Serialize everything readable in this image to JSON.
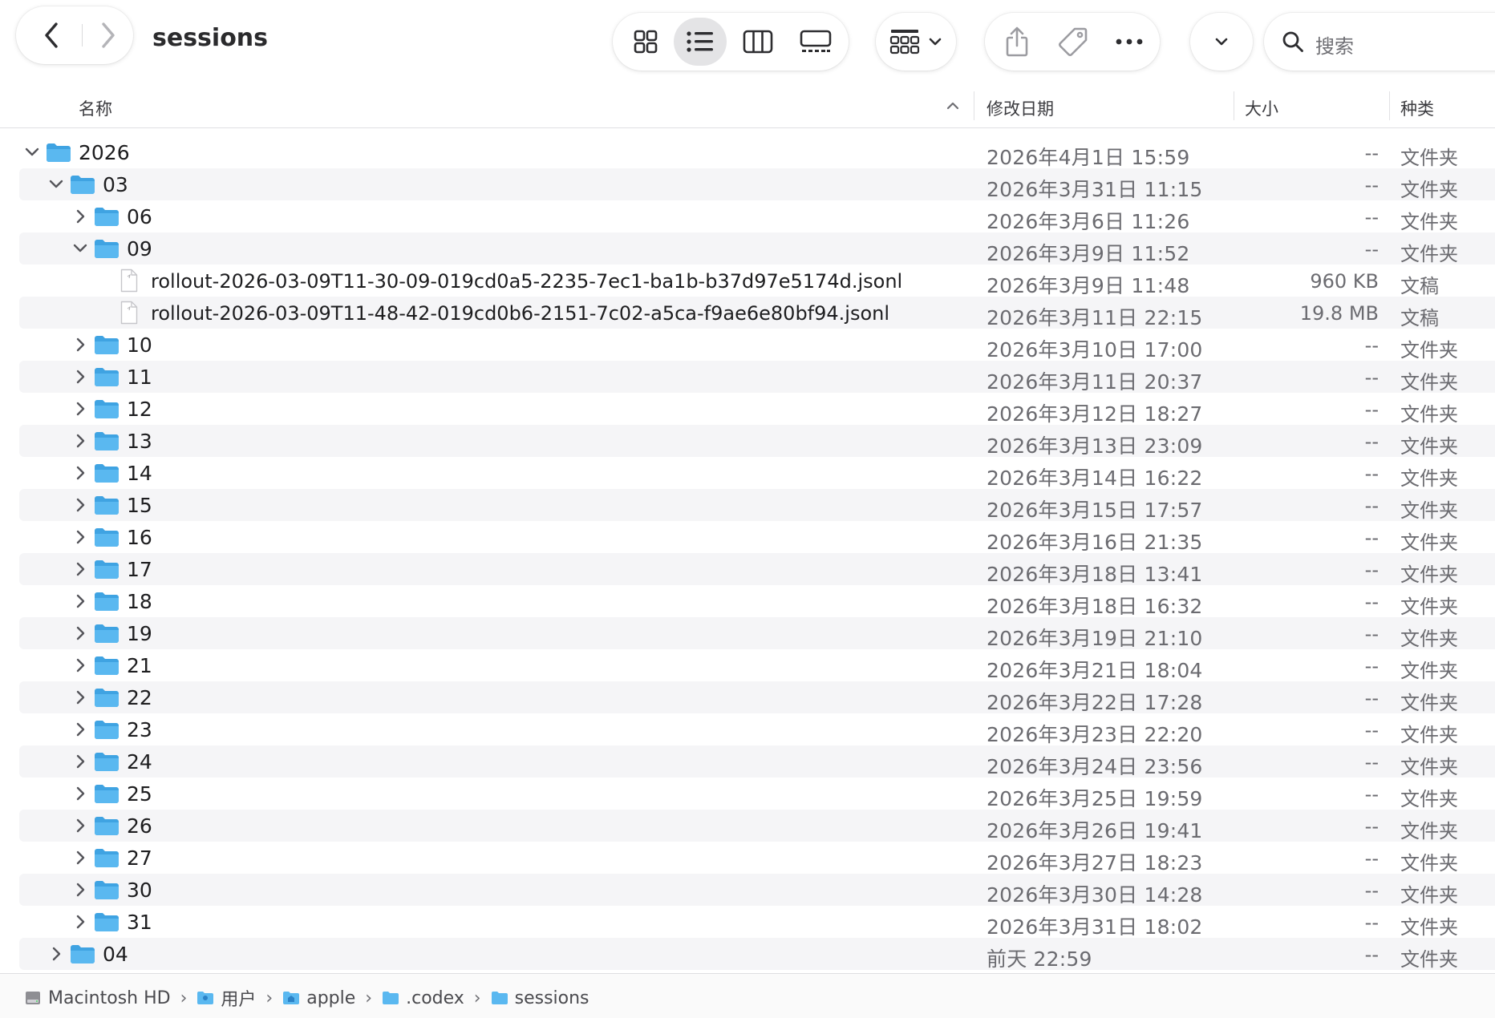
{
  "window": {
    "title": "sessions"
  },
  "search": {
    "placeholder": "搜索"
  },
  "toolbar": {
    "icons": [
      "chevron-left-icon",
      "chevron-right-icon",
      "grid-view-icon",
      "list-view-icon",
      "column-view-icon",
      "gallery-view-icon",
      "group-icon",
      "share-icon",
      "tag-icon",
      "more-icon",
      "chevron-down-icon",
      "search-icon"
    ],
    "selected_view": "list"
  },
  "columns": {
    "name": "名称",
    "date": "修改日期",
    "size": "大小",
    "kind": "种类"
  },
  "colors": {
    "folder": "#5ab8f0",
    "folder_dark": "#3fa3e2",
    "stripe": "#f5f5f7"
  },
  "rows": [
    {
      "level": 0,
      "type": "folder",
      "expanded": true,
      "name": "2026",
      "date": "2026年4月1日 15:59",
      "size": "--",
      "kind": "文件夹"
    },
    {
      "level": 1,
      "type": "folder",
      "expanded": true,
      "name": "03",
      "date": "2026年3月31日 11:15",
      "size": "--",
      "kind": "文件夹"
    },
    {
      "level": 2,
      "type": "folder",
      "expanded": false,
      "name": "06",
      "date": "2026年3月6日 11:26",
      "size": "--",
      "kind": "文件夹"
    },
    {
      "level": 2,
      "type": "folder",
      "expanded": true,
      "name": "09",
      "date": "2026年3月9日 11:52",
      "size": "--",
      "kind": "文件夹"
    },
    {
      "level": 3,
      "type": "file",
      "name": "rollout-2026-03-09T11-30-09-019cd0a5-2235-7ec1-ba1b-b37d97e5174d.jsonl",
      "date": "2026年3月9日 11:48",
      "size": "960 KB",
      "kind": "文稿"
    },
    {
      "level": 3,
      "type": "file",
      "name": "rollout-2026-03-09T11-48-42-019cd0b6-2151-7c02-a5ca-f9ae6e80bf94.jsonl",
      "date": "2026年3月11日 22:15",
      "size": "19.8 MB",
      "kind": "文稿"
    },
    {
      "level": 2,
      "type": "folder",
      "expanded": false,
      "name": "10",
      "date": "2026年3月10日 17:00",
      "size": "--",
      "kind": "文件夹"
    },
    {
      "level": 2,
      "type": "folder",
      "expanded": false,
      "name": "11",
      "date": "2026年3月11日 20:37",
      "size": "--",
      "kind": "文件夹"
    },
    {
      "level": 2,
      "type": "folder",
      "expanded": false,
      "name": "12",
      "date": "2026年3月12日 18:27",
      "size": "--",
      "kind": "文件夹"
    },
    {
      "level": 2,
      "type": "folder",
      "expanded": false,
      "name": "13",
      "date": "2026年3月13日 23:09",
      "size": "--",
      "kind": "文件夹"
    },
    {
      "level": 2,
      "type": "folder",
      "expanded": false,
      "name": "14",
      "date": "2026年3月14日 16:22",
      "size": "--",
      "kind": "文件夹"
    },
    {
      "level": 2,
      "type": "folder",
      "expanded": false,
      "name": "15",
      "date": "2026年3月15日 17:57",
      "size": "--",
      "kind": "文件夹"
    },
    {
      "level": 2,
      "type": "folder",
      "expanded": false,
      "name": "16",
      "date": "2026年3月16日 21:35",
      "size": "--",
      "kind": "文件夹"
    },
    {
      "level": 2,
      "type": "folder",
      "expanded": false,
      "name": "17",
      "date": "2026年3月18日 13:41",
      "size": "--",
      "kind": "文件夹"
    },
    {
      "level": 2,
      "type": "folder",
      "expanded": false,
      "name": "18",
      "date": "2026年3月18日 16:32",
      "size": "--",
      "kind": "文件夹"
    },
    {
      "level": 2,
      "type": "folder",
      "expanded": false,
      "name": "19",
      "date": "2026年3月19日 21:10",
      "size": "--",
      "kind": "文件夹"
    },
    {
      "level": 2,
      "type": "folder",
      "expanded": false,
      "name": "21",
      "date": "2026年3月21日 18:04",
      "size": "--",
      "kind": "文件夹"
    },
    {
      "level": 2,
      "type": "folder",
      "expanded": false,
      "name": "22",
      "date": "2026年3月22日 17:28",
      "size": "--",
      "kind": "文件夹"
    },
    {
      "level": 2,
      "type": "folder",
      "expanded": false,
      "name": "23",
      "date": "2026年3月23日 22:20",
      "size": "--",
      "kind": "文件夹"
    },
    {
      "level": 2,
      "type": "folder",
      "expanded": false,
      "name": "24",
      "date": "2026年3月24日 23:56",
      "size": "--",
      "kind": "文件夹"
    },
    {
      "level": 2,
      "type": "folder",
      "expanded": false,
      "name": "25",
      "date": "2026年3月25日 19:59",
      "size": "--",
      "kind": "文件夹"
    },
    {
      "level": 2,
      "type": "folder",
      "expanded": false,
      "name": "26",
      "date": "2026年3月26日 19:41",
      "size": "--",
      "kind": "文件夹"
    },
    {
      "level": 2,
      "type": "folder",
      "expanded": false,
      "name": "27",
      "date": "2026年3月27日 18:23",
      "size": "--",
      "kind": "文件夹"
    },
    {
      "level": 2,
      "type": "folder",
      "expanded": false,
      "name": "30",
      "date": "2026年3月30日 14:28",
      "size": "--",
      "kind": "文件夹"
    },
    {
      "level": 2,
      "type": "folder",
      "expanded": false,
      "name": "31",
      "date": "2026年3月31日 18:02",
      "size": "--",
      "kind": "文件夹"
    },
    {
      "level": 1,
      "type": "folder",
      "expanded": false,
      "name": "04",
      "date": "前天 22:59",
      "size": "--",
      "kind": "文件夹"
    }
  ],
  "pathbar": [
    {
      "label": "Macintosh HD",
      "icon": "hard-drive-icon"
    },
    {
      "label": "用户",
      "icon": "users-folder-icon"
    },
    {
      "label": "apple",
      "icon": "home-folder-icon"
    },
    {
      "label": ".codex",
      "icon": "folder-icon"
    },
    {
      "label": "sessions",
      "icon": "folder-icon"
    }
  ]
}
